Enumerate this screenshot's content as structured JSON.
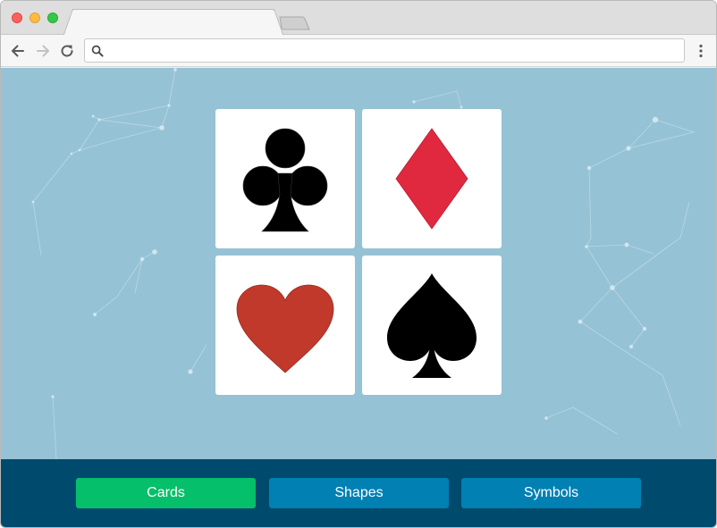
{
  "browser": {
    "tab_title": "",
    "address": {
      "value": "",
      "placeholder": ""
    },
    "icons": {
      "back": "arrow-left-icon",
      "forward": "arrow-right-icon",
      "reload": "reload-icon",
      "search": "search-icon",
      "menu": "kebab-menu-icon"
    }
  },
  "cards": [
    {
      "suit": "clubs",
      "symbol": "club-icon",
      "color": "#000000"
    },
    {
      "suit": "diamonds",
      "symbol": "diamond-icon",
      "color": "#e0283f"
    },
    {
      "suit": "hearts",
      "symbol": "heart-icon",
      "color": "#c0392b"
    },
    {
      "suit": "spades",
      "symbol": "spade-icon",
      "color": "#000000"
    }
  ],
  "footer": {
    "buttons": [
      {
        "label": "Cards",
        "color": "#06bf6a"
      },
      {
        "label": "Shapes",
        "color": "#0080b3"
      },
      {
        "label": "Symbols",
        "color": "#0080b3"
      }
    ]
  },
  "colors": {
    "background": "#96c2d5",
    "footer": "#004a6d"
  }
}
